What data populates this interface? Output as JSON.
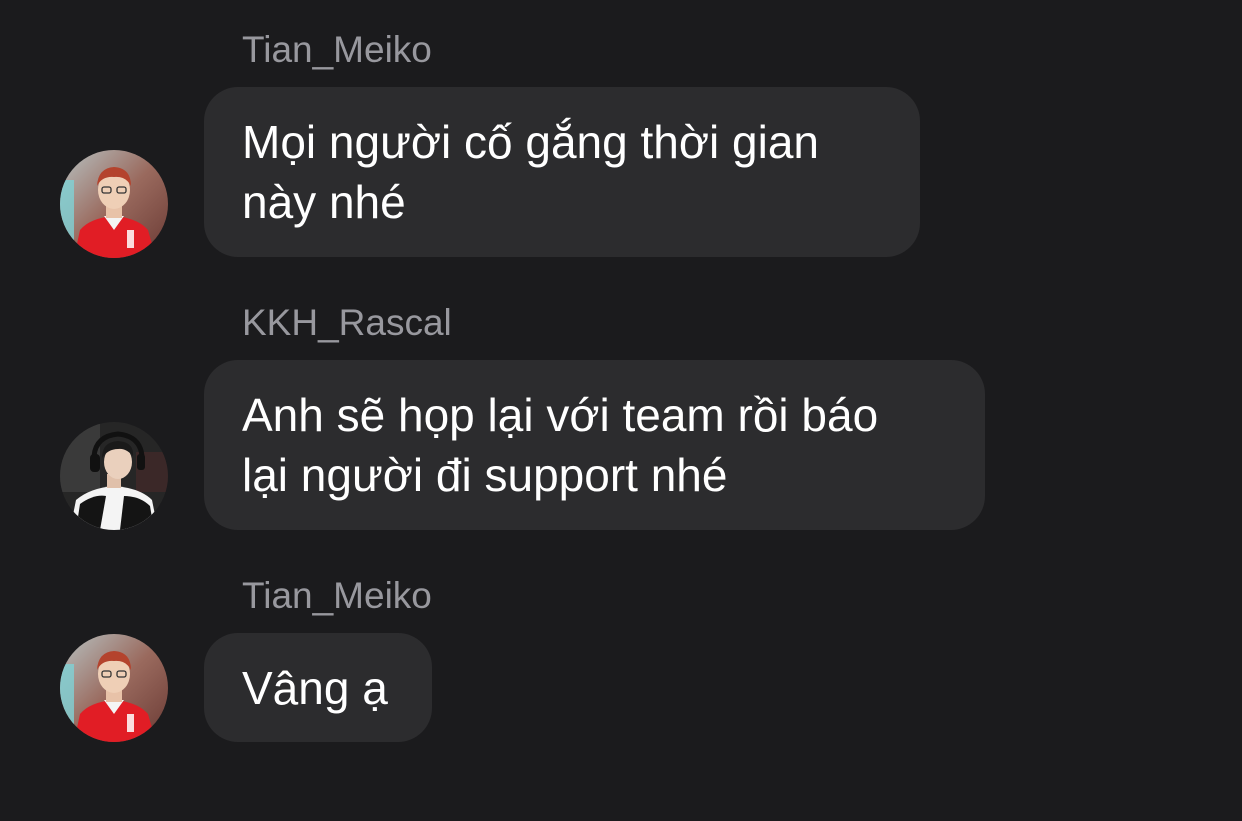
{
  "messages": [
    {
      "sender": "Tian_Meiko",
      "text": "Mọi người cố gắng thời gian\nnày nhé",
      "avatar": "tian-meiko-avatar"
    },
    {
      "sender": "KKH_Rascal",
      "text": "Anh sẽ họp lại với team rồi báo\nlại người đi support nhé",
      "avatar": "kkh-rascal-avatar"
    },
    {
      "sender": "Tian_Meiko",
      "text": "Vâng ạ",
      "avatar": "tian-meiko-avatar"
    }
  ],
  "colors": {
    "background": "#1b1b1d",
    "bubble": "#2c2c2e",
    "sender_name": "#98989e",
    "message_text": "#ffffff",
    "jersey_red": "#e11d25"
  }
}
